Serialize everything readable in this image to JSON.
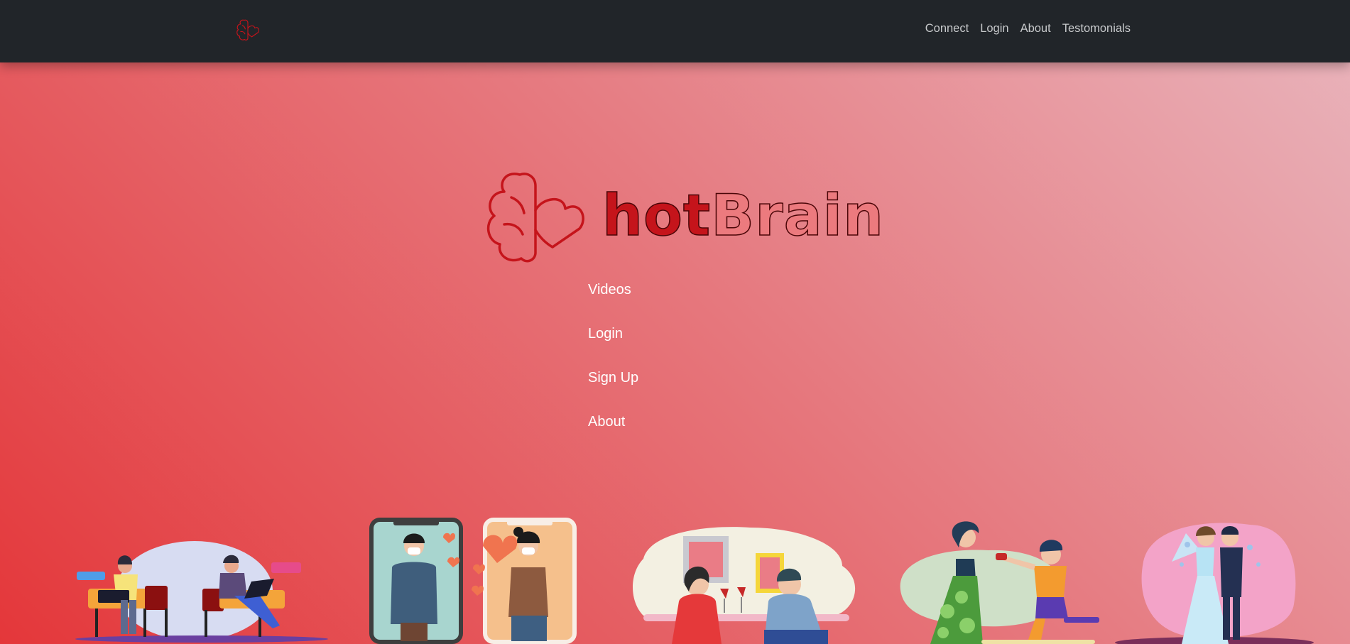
{
  "nav": {
    "logo_icon": "brain-heart-icon",
    "links": [
      "Connect",
      "Login",
      "About",
      "Testomonials"
    ]
  },
  "hero": {
    "logo_icon": "brain-heart-icon",
    "brand_part1": "hot",
    "brand_part2": "Brain",
    "menu": [
      "Videos",
      "Login",
      "Sign Up",
      "About"
    ]
  },
  "illustrations": [
    "couple-chatting-on-laptops-illustration",
    "video-call-couple-with-masks-illustration",
    "dinner-date-couple-illustration",
    "marriage-proposal-illustration",
    "wedding-couple-illustration"
  ],
  "colors": {
    "navbar": "#212529",
    "nav_link": "#c7c9cb",
    "brand_dark_red": "#c5141b",
    "brand_light_red": "#ec7a7e",
    "gradient_start": "#e4373a",
    "gradient_end": "#e9b5bd"
  }
}
